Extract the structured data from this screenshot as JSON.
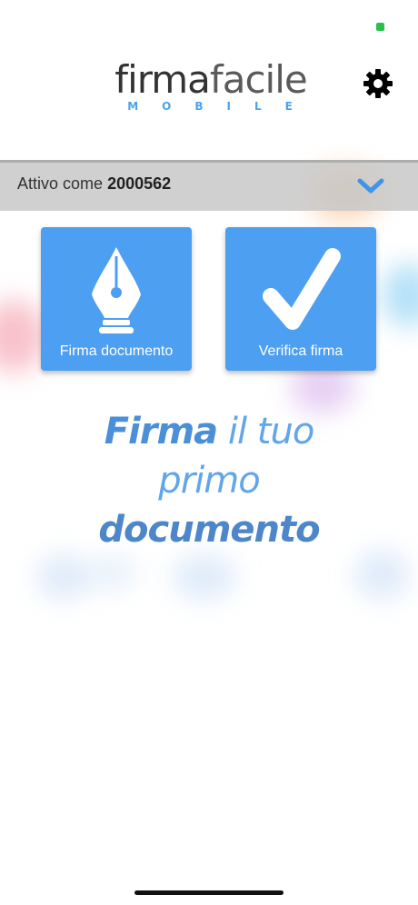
{
  "logo": {
    "word_bold": "firma",
    "word_light": "facile",
    "sub": "MOBILE"
  },
  "account": {
    "prefix": "Attivo come",
    "id": "2000562"
  },
  "tiles": {
    "sign_label": "Firma documento",
    "verify_label": "Verifica firma"
  },
  "headline": {
    "line1_bold": "Firma",
    "line1_light": " il tuo",
    "line2": "primo",
    "line3": "documento"
  },
  "icons": {
    "settings": "gear-icon",
    "dropdown": "chevron-down-icon",
    "sign": "pen-nib-icon",
    "verify": "checkmark-icon"
  },
  "colors": {
    "accent": "#4d9ff2",
    "headline": "#4a8fd8",
    "status": "#27c04a"
  }
}
